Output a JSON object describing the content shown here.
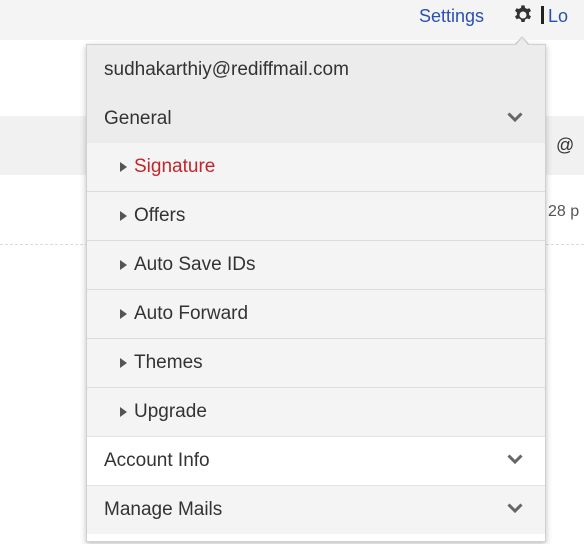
{
  "header": {
    "settings_label": "Settings",
    "gear_icon": "gear-icon",
    "logout_label": "Lo"
  },
  "background": {
    "at_symbol": "@",
    "time_fragment": "28 p"
  },
  "menu": {
    "email": "sudhakarthiy@rediffmail.com",
    "sections": [
      {
        "label": "General",
        "expanded": true,
        "items": [
          {
            "label": "Signature",
            "active": true
          },
          {
            "label": "Offers",
            "active": false
          },
          {
            "label": "Auto Save IDs",
            "active": false
          },
          {
            "label": "Auto Forward",
            "active": false
          },
          {
            "label": "Themes",
            "active": false
          },
          {
            "label": "Upgrade",
            "active": false
          }
        ]
      },
      {
        "label": "Account Info",
        "expanded": false
      },
      {
        "label": "Manage Mails",
        "expanded": false
      }
    ]
  },
  "colors": {
    "link": "#2a4fb3",
    "active_item": "#c0272d"
  }
}
